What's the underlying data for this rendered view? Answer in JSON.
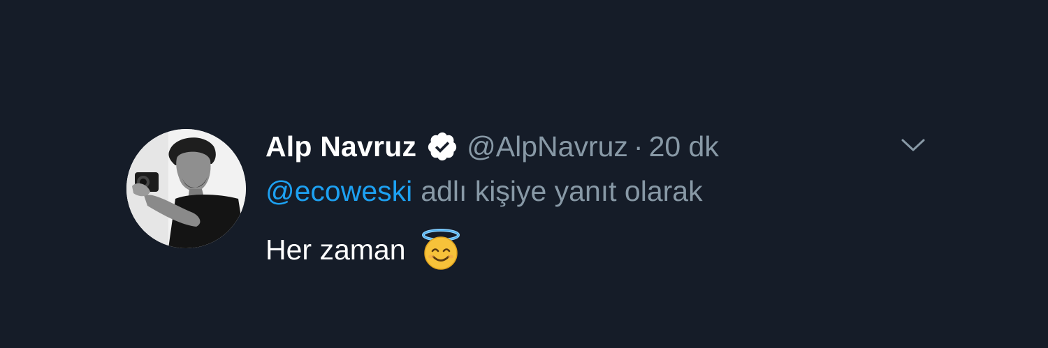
{
  "tweet": {
    "display_name": "Alp Navruz",
    "handle": "@AlpNavruz",
    "separator": "·",
    "time": "20 dk",
    "reply_to_mention": "@ecoweski",
    "reply_context": "adlı kişiye yanıt olarak",
    "text": "Her zaman",
    "emoji": "smiling-face-with-halo-icon"
  },
  "icons": {
    "verified": "verified-badge-icon",
    "menu": "chevron-down-icon"
  },
  "colors": {
    "background": "#151c28",
    "name": "#ffffff",
    "secondary_text": "#8899a6",
    "mention": "#1da1f2",
    "body_text": "#ffffff"
  }
}
